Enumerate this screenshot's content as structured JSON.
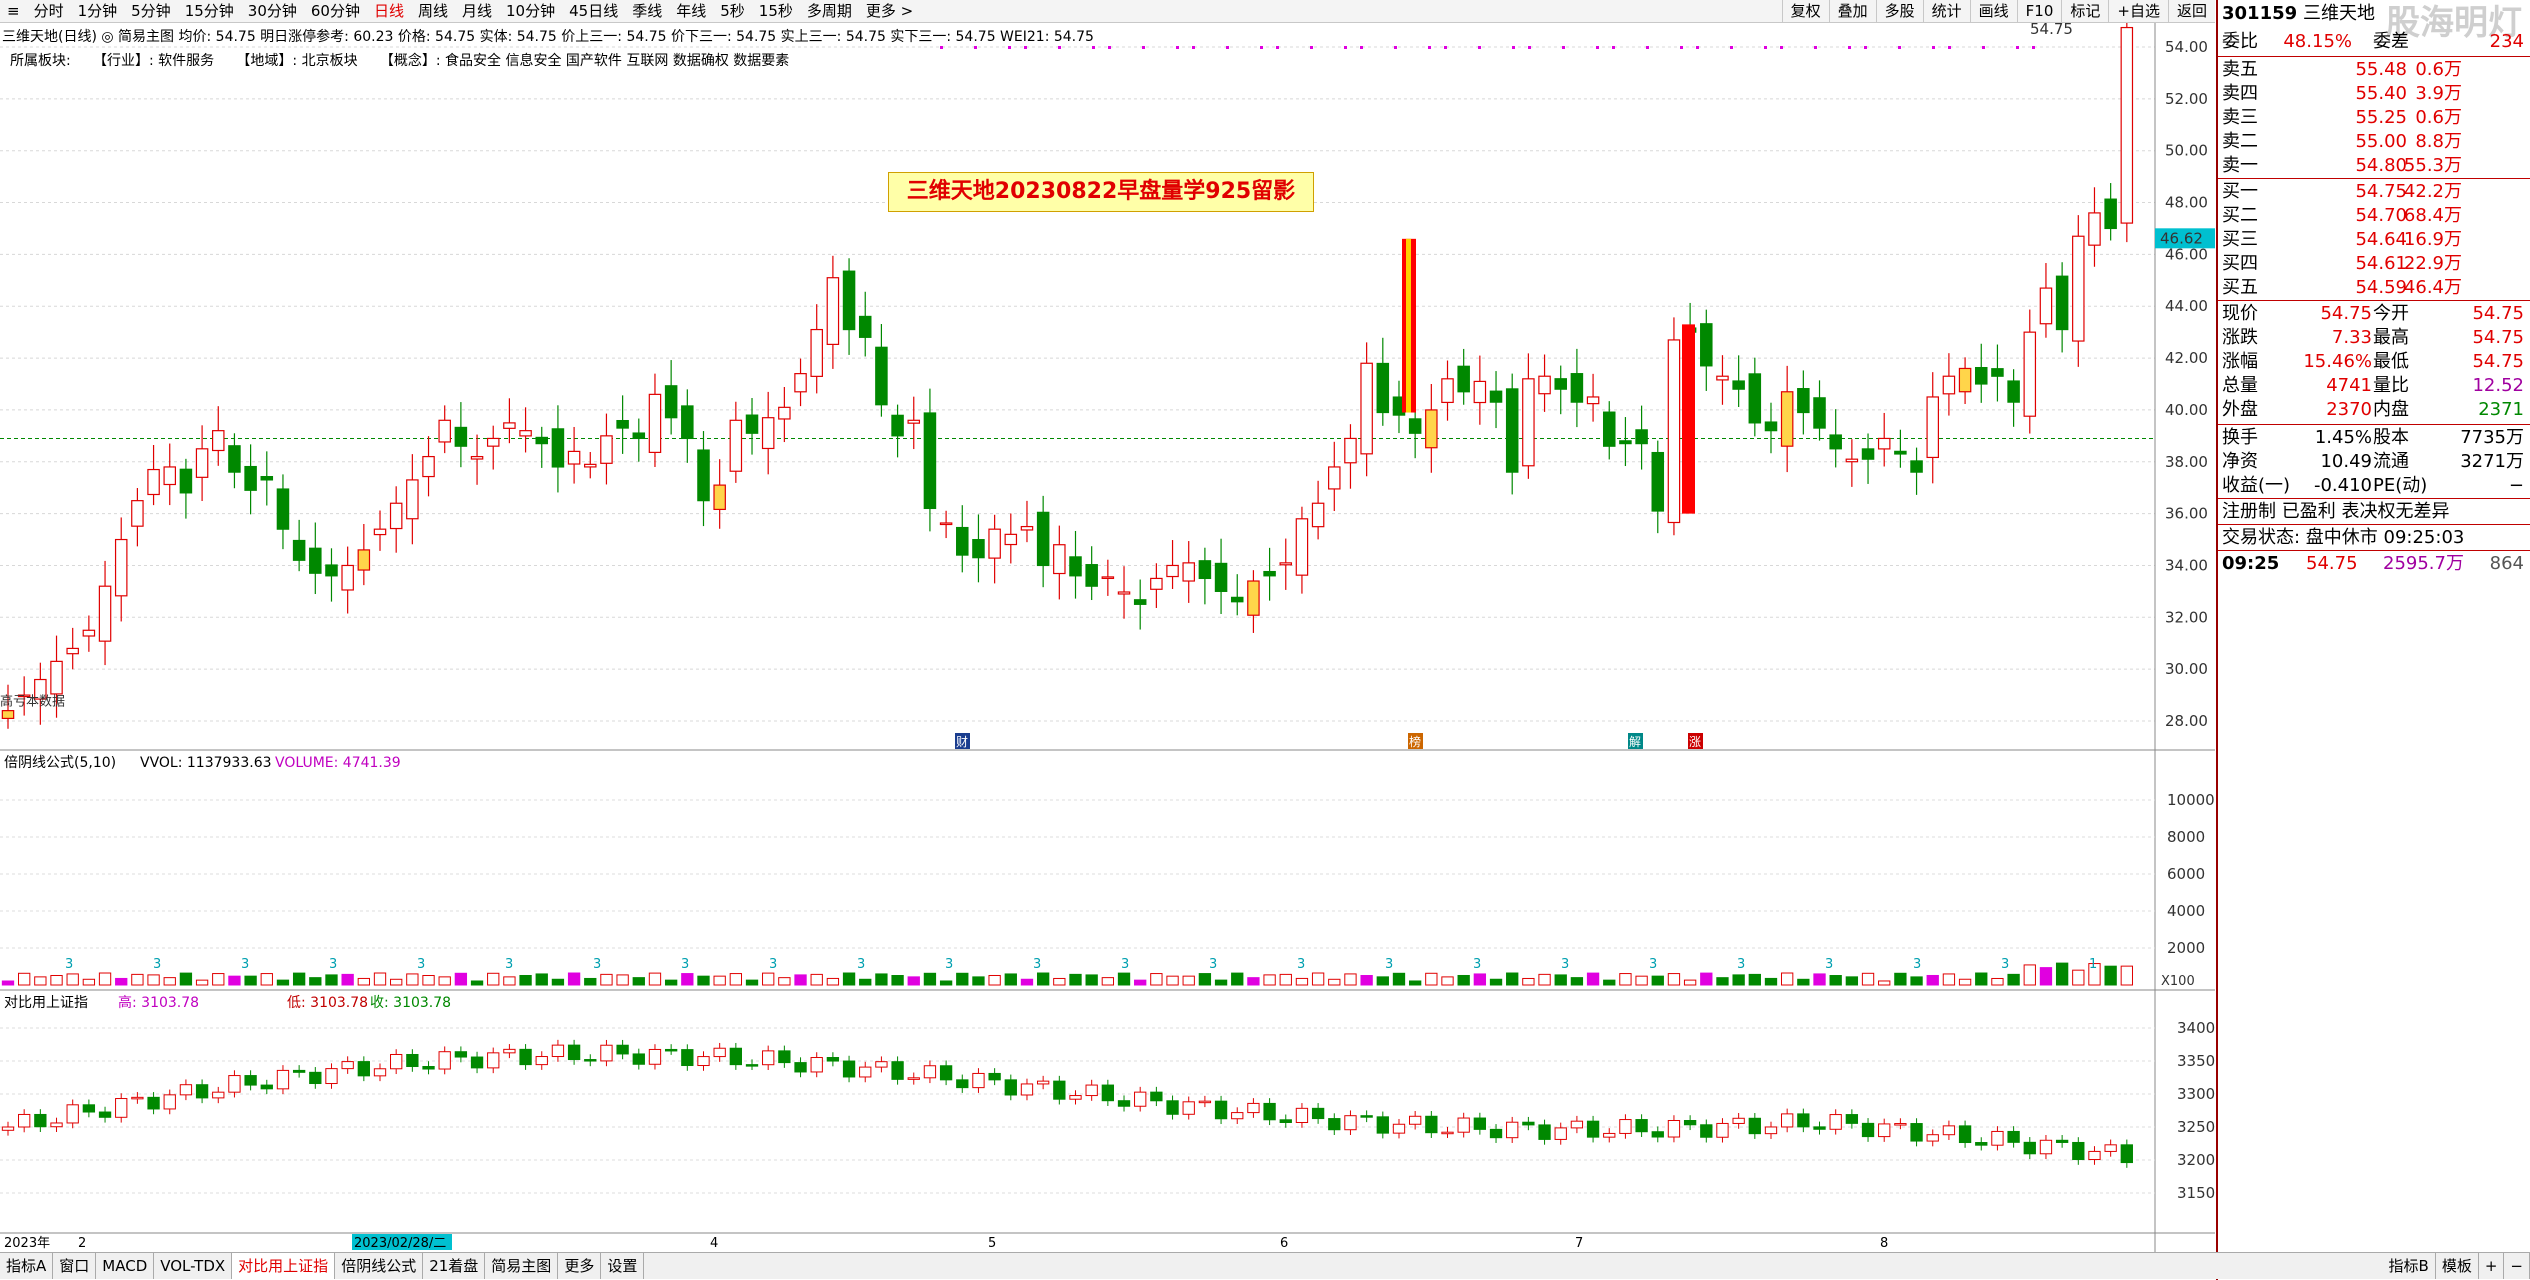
{
  "toolbar": {
    "periods": [
      "分时",
      "1分钟",
      "5分钟",
      "15分钟",
      "30分钟",
      "60分钟",
      "日线",
      "周线",
      "月线",
      "10分钟",
      "45日线",
      "季线",
      "年线",
      "5秒",
      "15秒",
      "多周期",
      "更多 >"
    ],
    "active_period": "日线",
    "right_tools": [
      "复权",
      "叠加",
      "多股",
      "统计",
      "画线",
      "F10",
      "标记",
      "+自选",
      "返回"
    ]
  },
  "stock_info": "三维天地(日线)  ◎ 简易主图  均价: 54.75  明日涨停参考: 60.23  价格: 54.75  实体: 54.75  价上三一: 54.75  价下三一: 54.75  实上三一: 54.75  实下三一: 54.75  WEI21: 54.75",
  "sector": {
    "label": "所属板块:",
    "industry": "【行业】: 软件服务",
    "region": "【地域】: 北京板块",
    "concept": "【概念】: 食品安全 信息安全 国产软件 互联网 数据确权 数据要素"
  },
  "banner": "三维天地20230822早盘量学925留影",
  "price_labels": {
    "last": "54.75",
    "cursor": "46.62",
    "low_note": "高亏本数据"
  },
  "main_axis": [
    "54.00",
    "52.00",
    "50.00",
    "48.00",
    "46.00",
    "44.00",
    "42.00",
    "40.00",
    "38.00",
    "36.00",
    "34.00",
    "32.00",
    "30.00",
    "28.00"
  ],
  "event_markers": [
    "财",
    "榜",
    "解",
    "涨"
  ],
  "vol_panel": {
    "title": "倍阴线公式(5,10)",
    "vvol_label": "VVOL: 1137933.63",
    "volume_label": "VOLUME: 4741.39",
    "axis": [
      "10000",
      "8000",
      "6000",
      "4000",
      "2000"
    ],
    "scale": "X100",
    "marks": [
      "3",
      "3",
      "3",
      "3",
      "3",
      "3",
      "3",
      "3",
      "3",
      "3",
      "3",
      "3",
      "3",
      "3",
      "3",
      "3",
      "3",
      "3",
      "3",
      "3",
      "3",
      "3",
      "3",
      "1"
    ]
  },
  "index_panel": {
    "title": "对比用上证指",
    "high": "高: 3103.78",
    "low": "低: 3103.78",
    "close": "收: 3103.78",
    "axis": [
      "3400",
      "3350",
      "3300",
      "3250",
      "3200",
      "3150"
    ]
  },
  "date_axis": {
    "year": "2023年",
    "months": [
      "2",
      "4",
      "5",
      "6",
      "7",
      "8"
    ],
    "cursor_date": "2023/02/28/二"
  },
  "bottom_tabs": [
    "指标A",
    "窗口",
    "MACD",
    "VOL-TDX",
    "对比用上证指",
    "倍阴线公式",
    "21着盘",
    "简易主图",
    "更多",
    "设置"
  ],
  "bottom_right": [
    "指标B",
    "模板",
    "+",
    "−"
  ],
  "quote": {
    "code": "301159",
    "name": "三维天地",
    "watermark": "股海明灯",
    "weibi_label": "委比",
    "weibi": "48.15%",
    "weicha_label": "委差",
    "weicha": "234",
    "sells": [
      {
        "label": "卖五",
        "price": "55.48",
        "vol": "0.6万"
      },
      {
        "label": "卖四",
        "price": "55.40",
        "vol": "3.9万"
      },
      {
        "label": "卖三",
        "price": "55.25",
        "vol": "0.6万"
      },
      {
        "label": "卖二",
        "price": "55.00",
        "vol": "8.8万"
      },
      {
        "label": "卖一",
        "price": "54.80",
        "vol": "55.3万"
      }
    ],
    "buys": [
      {
        "label": "买一",
        "price": "54.75",
        "vol": "42.2万"
      },
      {
        "label": "买二",
        "price": "54.70",
        "vol": "68.4万"
      },
      {
        "label": "买三",
        "price": "54.64",
        "vol": "16.9万"
      },
      {
        "label": "买四",
        "price": "54.61",
        "vol": "22.9万"
      },
      {
        "label": "买五",
        "price": "54.59",
        "vol": "46.4万"
      }
    ],
    "stats": [
      {
        "l1": "现价",
        "v1": "54.75",
        "l2": "今开",
        "v2": "54.75"
      },
      {
        "l1": "涨跌",
        "v1": "7.33",
        "l2": "最高",
        "v2": "54.75"
      },
      {
        "l1": "涨幅",
        "v1": "15.46%",
        "l2": "最低",
        "v2": "54.75"
      },
      {
        "l1": "总量",
        "v1": "4741",
        "l2": "量比",
        "v2": "12.52"
      },
      {
        "l1": "外盘",
        "v1": "2370",
        "l2": "内盘",
        "v2": "2371"
      }
    ],
    "stats2": [
      {
        "l1": "换手",
        "v1": "1.45%",
        "l2": "股本",
        "v2": "7735万"
      },
      {
        "l1": "净资",
        "v1": "10.49",
        "l2": "流通",
        "v2": "3271万"
      },
      {
        "l1": "收益(一)",
        "v1": "-0.410",
        "l2": "PE(动)",
        "v2": "−"
      }
    ],
    "reg": "注册制 已盈利 表决权无差异",
    "trade_status": "交易状态: 盘中休市 09:25:03",
    "tick": {
      "time": "09:25",
      "price": "54.75",
      "amount": "2595.7万",
      "vol": "864"
    }
  },
  "colors": {
    "up": "#e00000",
    "down": "#008800",
    "flat": "#ffd54a",
    "accent": "#00c0d0"
  }
}
